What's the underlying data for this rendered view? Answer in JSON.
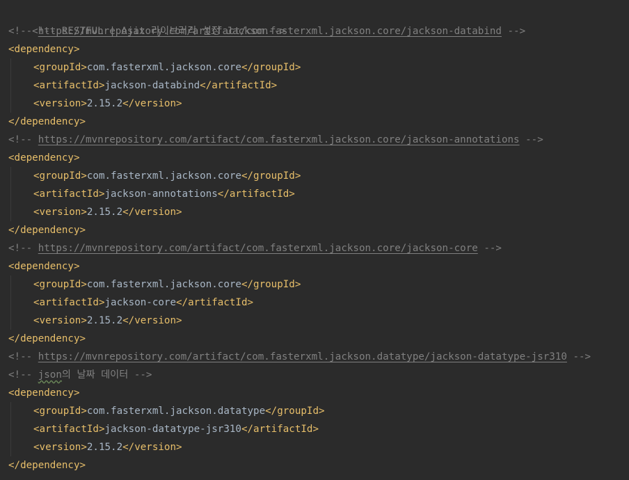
{
  "comments": {
    "header": "<!-- RESTFUL | Ajax 라이브러리 설정 Jackson-->",
    "open": "<!-- ",
    "close": " -->",
    "urls": [
      "https://mvnrepository.com/artifact/com.fasterxml.jackson.core/jackson-databind",
      "https://mvnrepository.com/artifact/com.fasterxml.jackson.core/jackson-annotations",
      "https://mvnrepository.com/artifact/com.fasterxml.jackson.core/jackson-core",
      "https://mvnrepository.com/artifact/com.fasterxml.jackson.datatype/jackson-datatype-jsr310"
    ],
    "json_note_word": "json",
    "json_note_rest": "의 날짜 데이터",
    "json_note_close": " -->"
  },
  "tags": {
    "dependency_open": "<dependency>",
    "dependency_close": "</dependency>",
    "groupId_open": "<groupId>",
    "groupId_close": "</groupId>",
    "artifactId_open": "<artifactId>",
    "artifactId_close": "</artifactId>",
    "version_open": "<version>",
    "version_close": "</version>"
  },
  "dependencies": [
    {
      "groupId": "com.fasterxml.jackson.core",
      "artifactId": "jackson-databind",
      "version": "2.15.2"
    },
    {
      "groupId": "com.fasterxml.jackson.core",
      "artifactId": "jackson-annotations",
      "version": "2.15.2"
    },
    {
      "groupId": "com.fasterxml.jackson.core",
      "artifactId": "jackson-core",
      "version": "2.15.2"
    },
    {
      "groupId": "com.fasterxml.jackson.datatype",
      "artifactId": "jackson-datatype-jsr310",
      "version": "2.15.2"
    }
  ],
  "colors": {
    "background": "#2b2b2b",
    "comment": "#808080",
    "tag": "#e8bf6a",
    "text": "#a9b7c6"
  }
}
